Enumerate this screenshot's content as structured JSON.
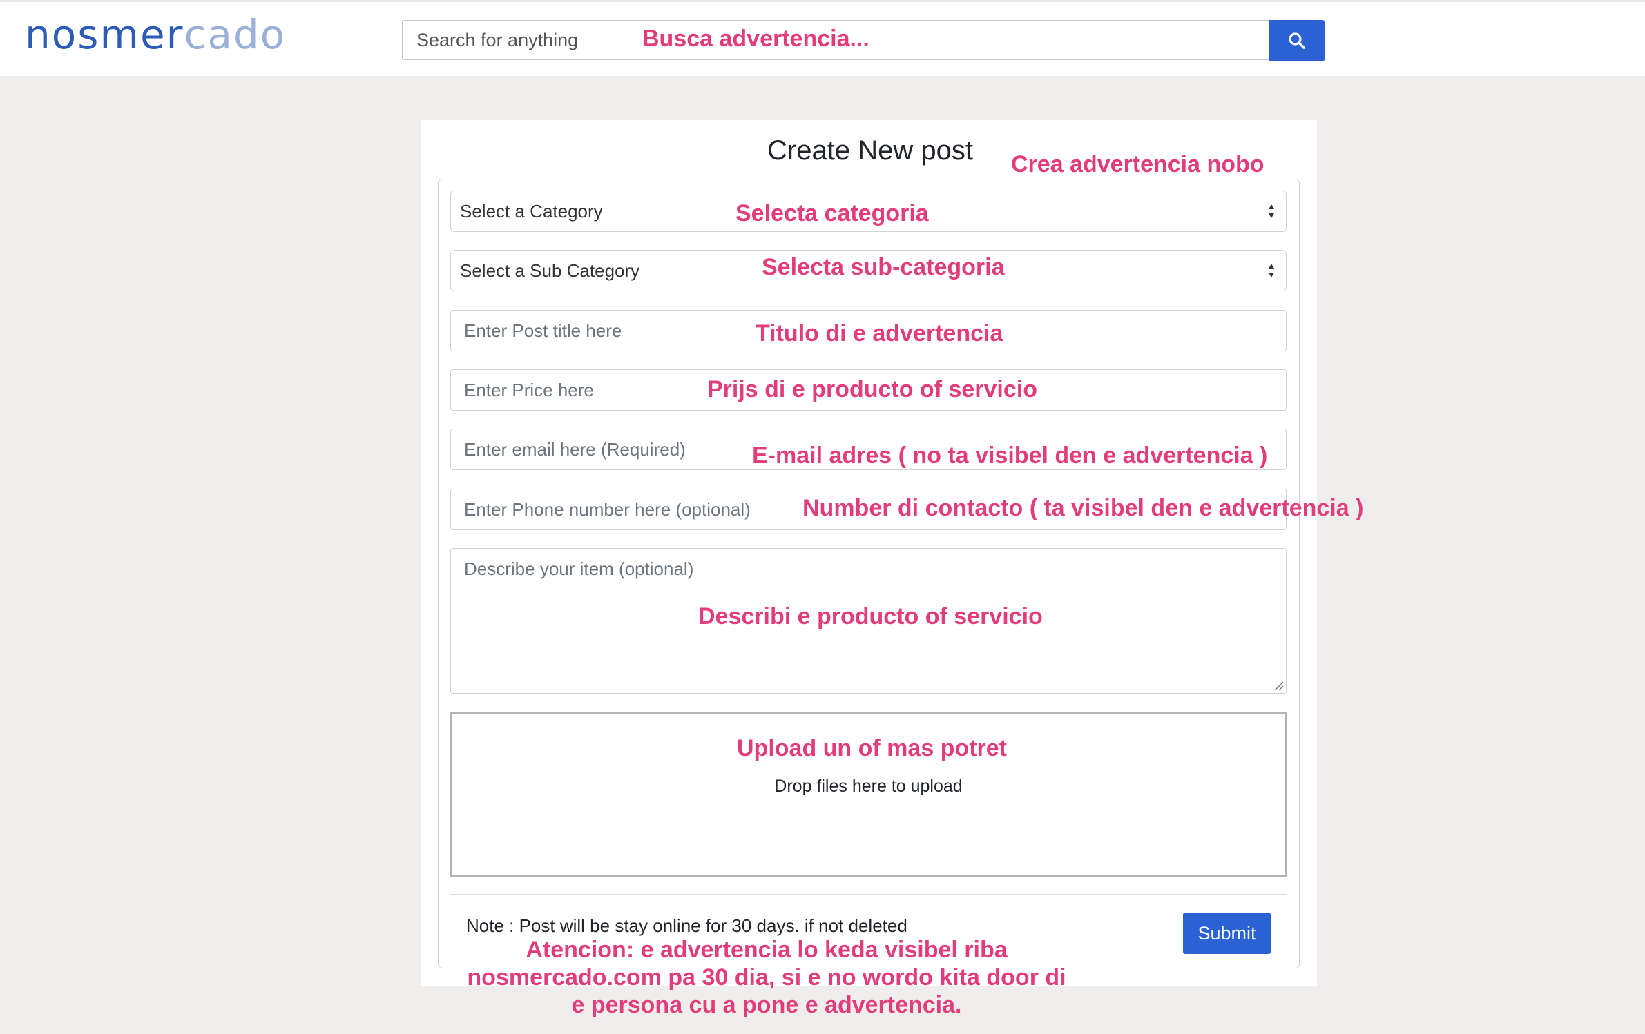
{
  "header": {
    "logo_part1": "nosmer",
    "logo_part2": "cado",
    "search_placeholder": "Search for anything",
    "search_icon": "search-icon"
  },
  "form": {
    "title": "Create New post",
    "category_select": "Select a Category",
    "subcategory_select": "Select a Sub Category",
    "title_placeholder": "Enter Post title here",
    "price_placeholder": "Enter Price here",
    "email_placeholder": "Enter email here (Required)",
    "phone_placeholder": "Enter Phone number here (optional)",
    "description_placeholder": "Describe your item (optional)",
    "dropzone_text": "Drop files here to upload",
    "note": "Note : Post will be stay online for 30 days. if not deleted",
    "submit_label": "Submit"
  },
  "annotations": {
    "search": "Busca advertencia...",
    "title": "Crea advertencia nobo",
    "category": "Selecta categoria",
    "subcategory": "Selecta sub-categoria",
    "post_title": "Titulo di e advertencia",
    "price": "Prijs di e producto of servicio",
    "email": "E-mail adres ( no ta visibel den e advertencia )",
    "phone": "Number di contacto ( ta visibel den e advertencia )",
    "description": "Describi e producto of servicio",
    "upload": "Upload un of mas potret",
    "note_line1": "Atencion: e advertencia lo keda visibel riba",
    "note_line2": "nosmercado.com pa 30 dia, si e no wordo kita door di",
    "note_line3": "e persona cu a pone e advertencia."
  },
  "colors": {
    "brand_blue": "#2a62d4",
    "annotation_pink": "#e33c7a",
    "background": "#efeeec"
  }
}
